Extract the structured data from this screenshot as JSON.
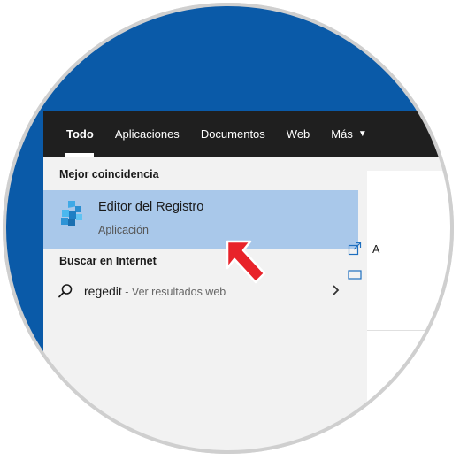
{
  "tabs": [
    {
      "label": "Todo"
    },
    {
      "label": "Aplicaciones"
    },
    {
      "label": "Documentos"
    },
    {
      "label": "Web"
    },
    {
      "label": "Más"
    }
  ],
  "best_match": {
    "section_title": "Mejor coincidencia",
    "app_name": "Editor del Registro",
    "app_type": "Aplicación",
    "icon": "registry-editor-icon"
  },
  "web_search": {
    "section_title": "Buscar en Internet",
    "query": "regedit",
    "suffix": " - Ver resultados web",
    "icon": "search-icon"
  },
  "side_panel": {
    "item1_text": "A"
  },
  "colors": {
    "desktop": "#0a5aa8",
    "tabbar": "#1f1f1f",
    "selected_row": "#a9c8ea",
    "cursor": "#e8232a"
  }
}
